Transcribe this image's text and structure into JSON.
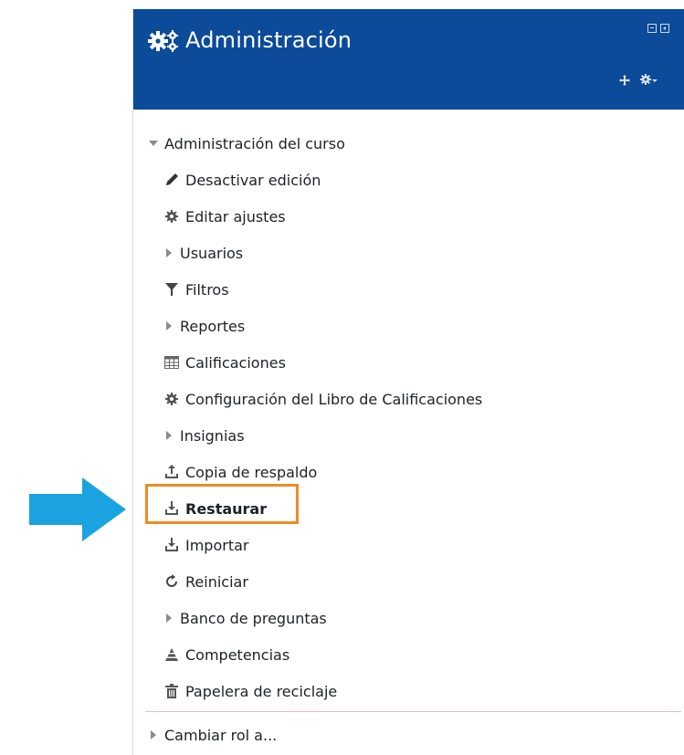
{
  "block": {
    "title": "Administración",
    "header_bg": "#0c4a9a"
  },
  "tree": {
    "section_label": "Administración del curso",
    "items": [
      {
        "label": "Desactivar edición",
        "icon": "pencil-icon"
      },
      {
        "label": "Editar ajustes",
        "icon": "gear-icon"
      },
      {
        "label": "Usuarios",
        "icon": "expand-triangle-icon"
      },
      {
        "label": "Filtros",
        "icon": "filter-icon"
      },
      {
        "label": "Reportes",
        "icon": "expand-triangle-icon"
      },
      {
        "label": "Calificaciones",
        "icon": "table-icon"
      },
      {
        "label": "Configuración del Libro de Calificaciones",
        "icon": "gear-icon"
      },
      {
        "label": "Insignias",
        "icon": "expand-triangle-icon"
      },
      {
        "label": "Copia de respaldo",
        "icon": "upload-icon"
      },
      {
        "label": "Restaurar",
        "icon": "download-icon"
      },
      {
        "label": "Importar",
        "icon": "download-icon"
      },
      {
        "label": "Reiniciar",
        "icon": "refresh-icon"
      },
      {
        "label": "Banco de preguntas",
        "icon": "expand-triangle-icon"
      },
      {
        "label": "Competencias",
        "icon": "pyramid-icon"
      },
      {
        "label": "Papelera de reciclaje",
        "icon": "trash-icon"
      }
    ],
    "footer_item": "Cambiar rol a..."
  },
  "annotation": {
    "arrow_color": "#1aa3e0",
    "highlight_color": "#f18a26"
  }
}
